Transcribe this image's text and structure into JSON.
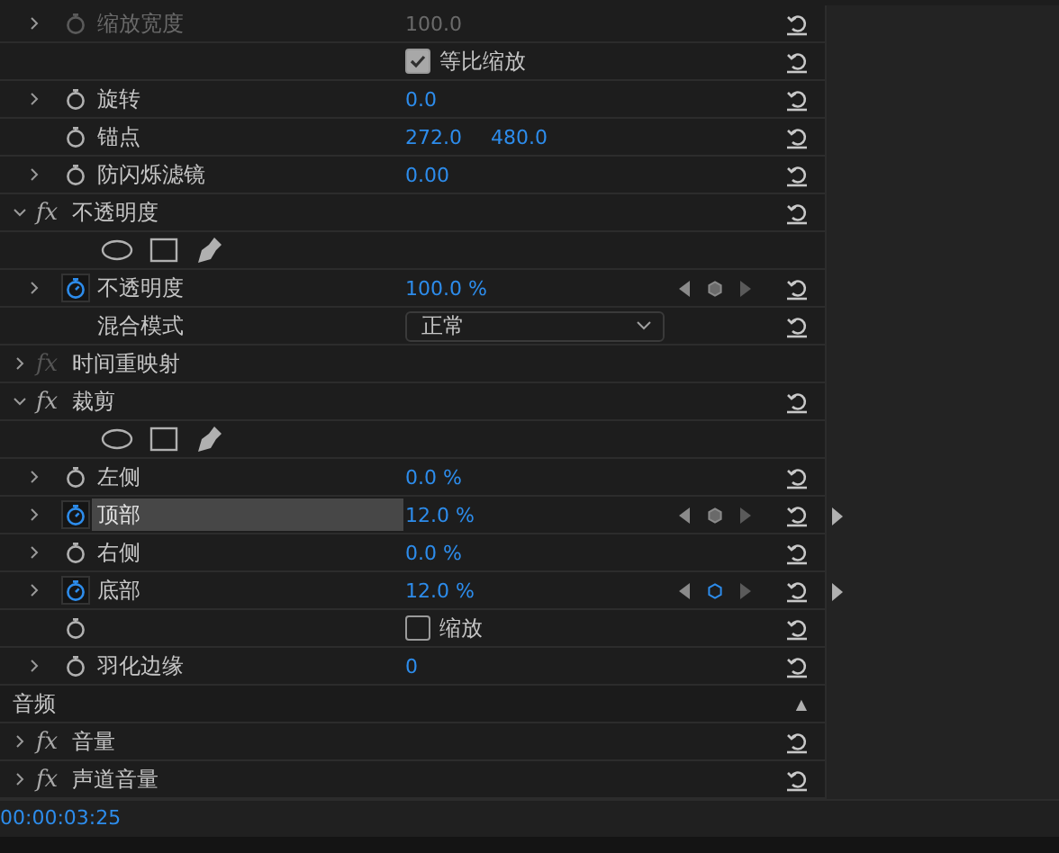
{
  "rows": [
    {
      "kind": "property",
      "expandable": true,
      "stopwatch": true,
      "animating": false,
      "label": "缩放宽度",
      "values": [
        "100.0"
      ],
      "disabled": true,
      "selected": false,
      "reset": true
    },
    {
      "kind": "checkbox",
      "stopwatch": false,
      "label": "等比缩放",
      "checked": true,
      "reset": true
    },
    {
      "kind": "property",
      "expandable": true,
      "stopwatch": true,
      "animating": false,
      "label": "旋转",
      "values": [
        "0.0"
      ],
      "disabled": false,
      "selected": false,
      "reset": true
    },
    {
      "kind": "property",
      "expandable": false,
      "stopwatch": true,
      "animating": false,
      "label": "锚点",
      "values": [
        "272.0",
        "480.0"
      ],
      "disabled": false,
      "selected": false,
      "reset": true
    },
    {
      "kind": "property",
      "expandable": true,
      "stopwatch": true,
      "animating": false,
      "label": "防闪烁滤镜",
      "values": [
        "0.00"
      ],
      "disabled": false,
      "selected": false,
      "reset": true
    },
    {
      "kind": "effect",
      "badge": "fx",
      "label": "不透明度",
      "expanded": true,
      "enabled": true,
      "reset": true
    },
    {
      "kind": "masks"
    },
    {
      "kind": "property",
      "expandable": true,
      "stopwatch": true,
      "animating": true,
      "label": "不透明度",
      "values": [
        "100.0 %"
      ],
      "disabled": false,
      "selected": false,
      "keyframe_nav": true,
      "at_keyframe": false,
      "timeline_arrow": false,
      "reset": true
    },
    {
      "kind": "dropdown",
      "label": "混合模式",
      "value": "正常",
      "reset": true
    },
    {
      "kind": "effect",
      "badge": "fx",
      "label": "时间重映射",
      "expanded": false,
      "enabled": false,
      "reset": false
    },
    {
      "kind": "effect",
      "badge": "fx",
      "label": "裁剪",
      "expanded": true,
      "enabled": true,
      "reset": true
    },
    {
      "kind": "masks"
    },
    {
      "kind": "property",
      "expandable": true,
      "stopwatch": true,
      "animating": false,
      "label": "左侧",
      "values": [
        "0.0 %"
      ],
      "disabled": false,
      "selected": false,
      "reset": true
    },
    {
      "kind": "property",
      "expandable": true,
      "stopwatch": true,
      "animating": true,
      "label": "顶部",
      "values": [
        "12.0 %"
      ],
      "disabled": false,
      "selected": true,
      "keyframe_nav": true,
      "at_keyframe": false,
      "timeline_arrow": true,
      "reset": true
    },
    {
      "kind": "property",
      "expandable": true,
      "stopwatch": true,
      "animating": false,
      "label": "右侧",
      "values": [
        "0.0 %"
      ],
      "disabled": false,
      "selected": false,
      "reset": true
    },
    {
      "kind": "property",
      "expandable": true,
      "stopwatch": true,
      "animating": true,
      "label": "底部",
      "values": [
        "12.0 %"
      ],
      "disabled": false,
      "selected": false,
      "keyframe_nav": true,
      "at_keyframe": true,
      "timeline_arrow": true,
      "reset": true
    },
    {
      "kind": "checkbox",
      "stopwatch": true,
      "label": "缩放",
      "checked": false,
      "reset": true
    },
    {
      "kind": "property",
      "expandable": true,
      "stopwatch": true,
      "animating": false,
      "label": "羽化边缘",
      "values": [
        "0"
      ],
      "disabled": false,
      "selected": false,
      "reset": true
    },
    {
      "kind": "section",
      "label": "音频",
      "toggle": "▲"
    },
    {
      "kind": "effect",
      "badge": "fx",
      "label": "音量",
      "expanded": false,
      "enabled": true,
      "reset": true
    },
    {
      "kind": "effect",
      "badge": "fx",
      "label": "声道音量",
      "expanded": false,
      "enabled": true,
      "reset": true
    }
  ],
  "timecode": "00:00:03:25"
}
